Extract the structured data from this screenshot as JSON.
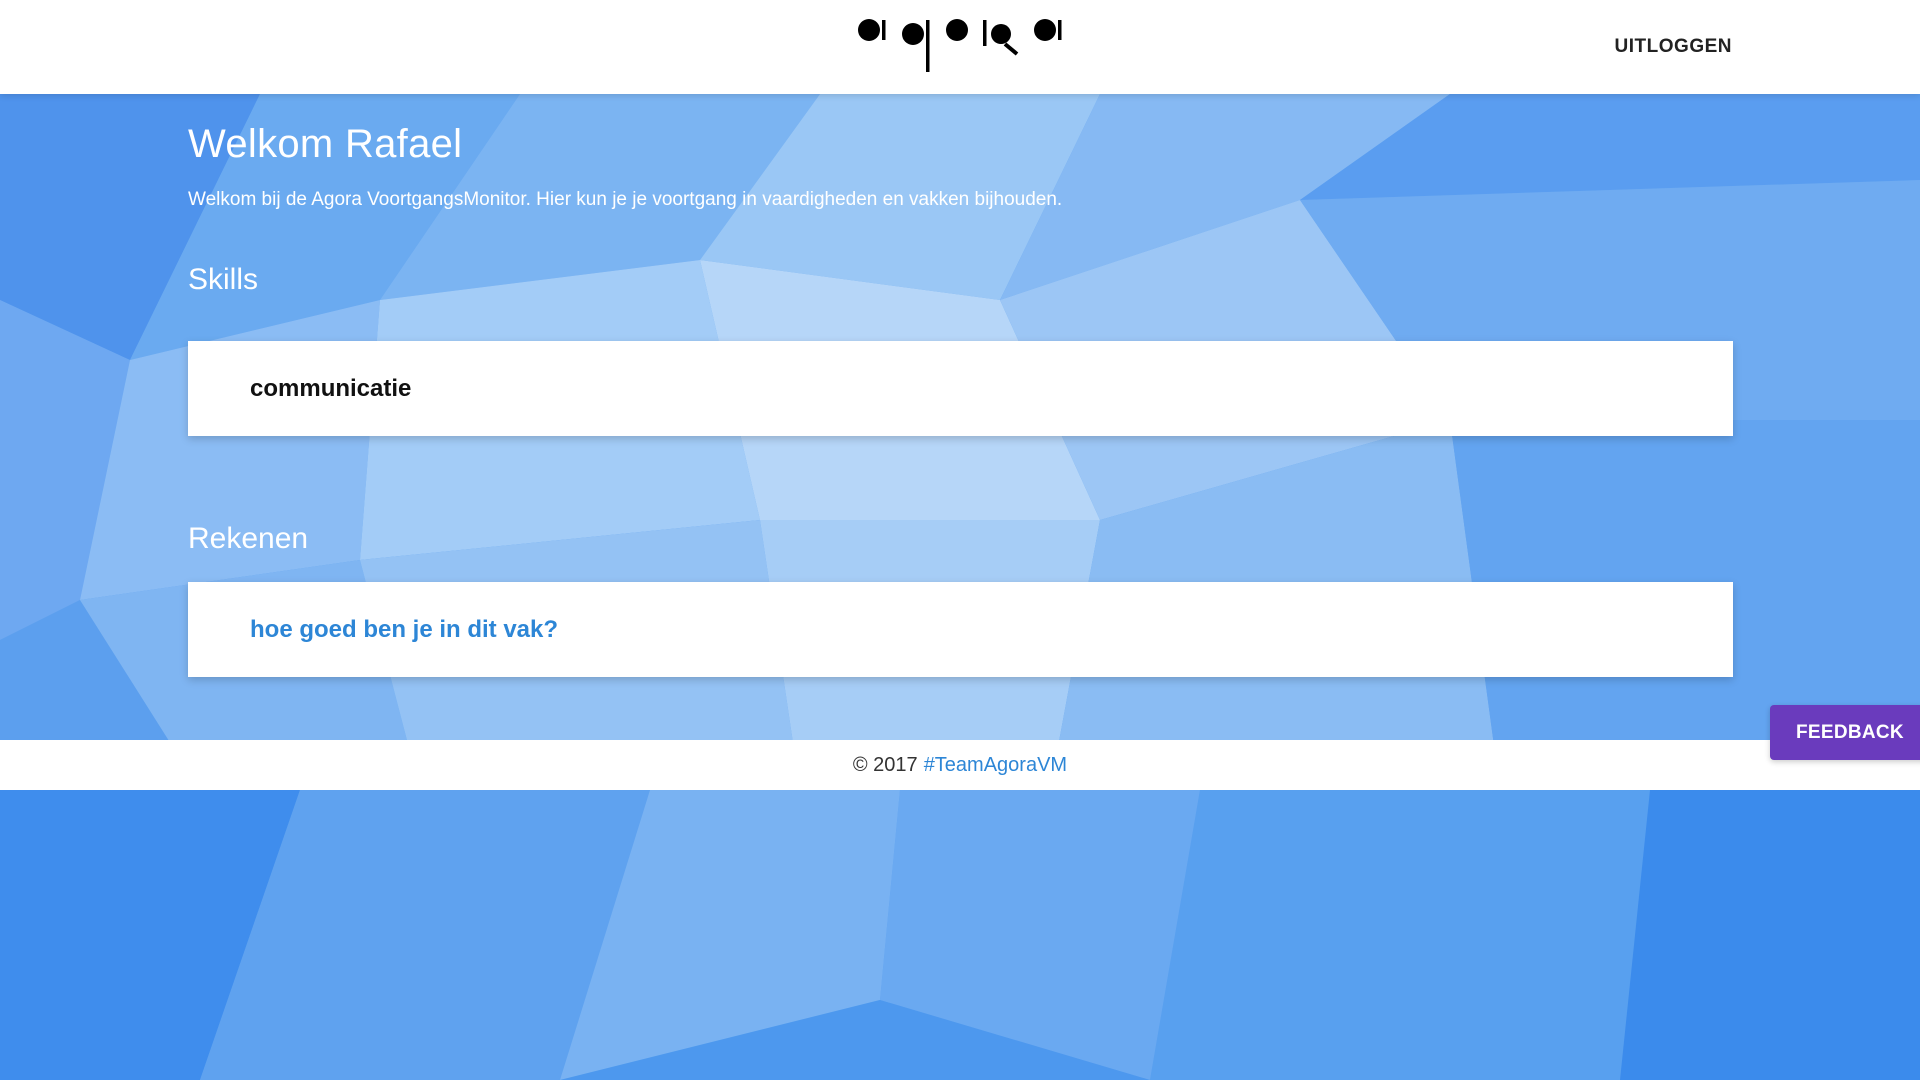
{
  "header": {
    "logout_label": "UITLOGGEN"
  },
  "main": {
    "welcome_title": "Welkom Rafael",
    "welcome_text": "Welkom bij de Agora VoortgangsMonitor. Hier kun je je voortgang in vaardigheden en vakken bijhouden.",
    "skills": {
      "title": "Skills",
      "items": [
        "communicatie"
      ]
    },
    "rekenen": {
      "title": "Rekenen",
      "link_label": "hoe goed ben je in dit vak?"
    }
  },
  "footer": {
    "copyright": "© 2017",
    "link_label": "#TeamAgoraVM"
  },
  "feedback_label": "FEEDBACK",
  "colors": {
    "background": "#5ea2ee",
    "link": "#2d86d6",
    "feedback": "#6a3bbd"
  },
  "icons": {
    "logo": "agora-logo"
  }
}
